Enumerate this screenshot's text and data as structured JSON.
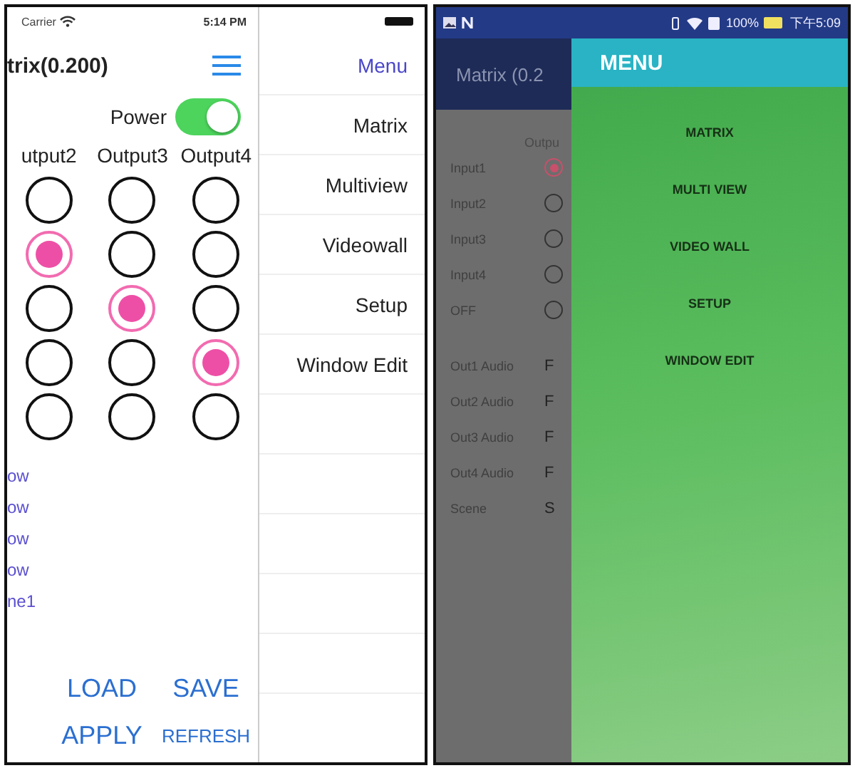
{
  "ios": {
    "status": {
      "carrier": "Carrier",
      "time": "5:14 PM"
    },
    "title": "trix(0.200)",
    "power": {
      "label": "Power",
      "on": true
    },
    "columns": [
      "utput2",
      "Output3",
      "Output4"
    ],
    "grid": [
      [
        {
          "selected": false
        },
        {
          "selected": false
        },
        {
          "selected": false
        }
      ],
      [
        {
          "selected": true
        },
        {
          "selected": false
        },
        {
          "selected": false
        }
      ],
      [
        {
          "selected": false
        },
        {
          "selected": true
        },
        {
          "selected": false
        }
      ],
      [
        {
          "selected": false
        },
        {
          "selected": false
        },
        {
          "selected": true
        }
      ],
      [
        {
          "selected": false
        },
        {
          "selected": false
        },
        {
          "selected": false
        }
      ]
    ],
    "links": [
      "ow",
      "ow",
      "ow",
      "ow",
      "ne1"
    ],
    "buttons": [
      {
        "label": "LOAD",
        "kind": "big"
      },
      {
        "label": "SAVE",
        "kind": "big"
      },
      {
        "label": "APPLY",
        "kind": "big"
      },
      {
        "label": "REFRESH",
        "kind": "small"
      }
    ],
    "menu": {
      "header": "Menu",
      "items": [
        "Matrix",
        "Multiview",
        "Videowall",
        "Setup",
        "Window Edit"
      ]
    }
  },
  "android": {
    "status": {
      "battery": "100%",
      "time": "下午5:09"
    },
    "title": "Matrix (0.2",
    "column": "Outpu",
    "inputs": [
      {
        "label": "Input1",
        "selected": true
      },
      {
        "label": "Input2",
        "selected": false
      },
      {
        "label": "Input3",
        "selected": false
      },
      {
        "label": "Input4",
        "selected": false
      },
      {
        "label": "OFF",
        "selected": false
      }
    ],
    "audio": [
      {
        "label": "Out1 Audio",
        "value": "F"
      },
      {
        "label": "Out2 Audio",
        "value": "F"
      },
      {
        "label": "Out3 Audio",
        "value": "F"
      },
      {
        "label": "Out4 Audio",
        "value": "F"
      },
      {
        "label": "Scene",
        "value": "S"
      }
    ],
    "menu": {
      "title": "MENU",
      "items": [
        "MATRIX",
        "MULTI VIEW",
        "VIDEO WALL",
        "SETUP",
        "WINDOW EDIT"
      ]
    }
  }
}
